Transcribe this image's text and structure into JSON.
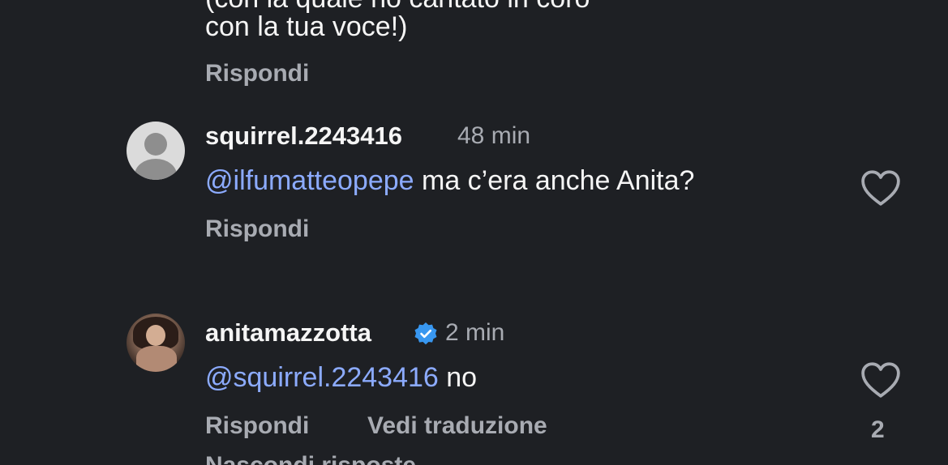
{
  "comments": {
    "previous": {
      "text_line_clipped": "(con la quale ho cantato in coro",
      "text_line2": "con la tua voce!)",
      "reply_label": "Rispondi"
    },
    "squirrel": {
      "username": "squirrel.2243416",
      "time": "48 min",
      "mention": "@ilfumatteopepe",
      "text": " ma c’era anche Anita?",
      "reply_label": "Rispondi",
      "liked": false
    },
    "anita": {
      "username": "anitamazzotta",
      "verified": true,
      "time": "2 min",
      "mention": "@squirrel.2243416",
      "text": " no",
      "reply_label": "Rispondi",
      "translate_label": "Vedi traduzione",
      "like_count": "2",
      "liked": false
    },
    "hidden_replies": {
      "label": "Nascondi risposte"
    }
  },
  "colors": {
    "background": "#1e2024",
    "text": "#f5f5f5",
    "secondary": "#a8abb2",
    "mention": "#8cabff",
    "verified": "#3897f0"
  },
  "icons": {
    "like": "heart-outline-icon",
    "verified": "verified-badge-icon",
    "default_avatar": "default-avatar-icon"
  }
}
